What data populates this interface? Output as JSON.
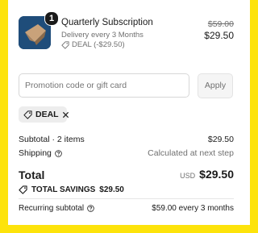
{
  "line_item": {
    "quantity": "1",
    "title": "Quarterly Subscription",
    "delivery": "Delivery every 3 Months",
    "discount": "DEAL (-$29.50)",
    "original_price": "$59.00",
    "price": "$29.50"
  },
  "promo": {
    "placeholder": "Promotion code or gift card",
    "apply_label": "Apply",
    "applied_code": "DEAL"
  },
  "summary": {
    "subtotal_label": "Subtotal · 2 items",
    "subtotal_value": "$29.50",
    "shipping_label": "Shipping",
    "shipping_value": "Calculated at next step",
    "total_label": "Total",
    "currency": "USD",
    "total_value": "$29.50",
    "savings_label": "TOTAL SAVINGS",
    "savings_value": "$29.50",
    "recurring_label": "Recurring subtotal",
    "recurring_value": "$59.00 every 3 months"
  },
  "colors": {
    "background": "#fde30b",
    "panel": "#ffffff",
    "thumbnail": "#1f4d7a"
  }
}
